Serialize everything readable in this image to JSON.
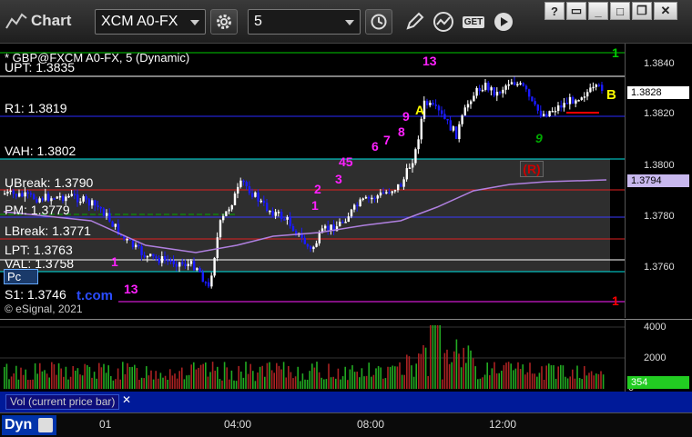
{
  "toolbar": {
    "title": "Chart",
    "symbol": "XCM A0-FX",
    "interval": "5",
    "get_label": "GET"
  },
  "window": {
    "minimize": "_",
    "restore": "❐",
    "close": "✕",
    "help": "?"
  },
  "chart": {
    "symbol_line": "* GBP@FXCM A0-FX, 5 (Dynamic)",
    "copyright": "© eSignal, 2021",
    "watermark": "t.com",
    "levels": [
      {
        "label": "UPT: 1.3835",
        "color": "#ffffff"
      },
      {
        "label": "R1: 1.3819",
        "color": "#2a2aff"
      },
      {
        "label": "VAH: 1.3802",
        "color": "#00e5e5"
      },
      {
        "label": "UBreak: 1.3790",
        "color": "#e02020"
      },
      {
        "label": "PM: 1.3779",
        "color": "#3a3aff"
      },
      {
        "label": "LBreak: 1.3771",
        "color": "#e02020"
      },
      {
        "label": "LPT: 1.3763",
        "color": "#ffffff"
      },
      {
        "label": "VAL: 1.3758",
        "color": "#00e5e5"
      },
      {
        "label": "S1: 1.3746",
        "color": "#ff20ff"
      }
    ],
    "pc_label": "Pc",
    "r_label": "(R)",
    "b_label": "B",
    "price_axis": {
      "ticks": [
        "1.3840",
        "1.3820",
        "1.3800",
        "1.3780",
        "1.3760"
      ],
      "last_price": "1.3828",
      "ma_value": "1.3794"
    },
    "markers": {
      "m1": "1",
      "m2": "2",
      "m3": "3",
      "m45": "45",
      "m6": "6",
      "m7": "7",
      "m8": "8",
      "m9": "9",
      "m13": "13",
      "m1b": "1",
      "m13b": "13",
      "mA": "A",
      "mRed1": "1",
      "mGreen1": "1",
      "mGreen9": "9"
    }
  },
  "volume": {
    "label": "Vol (current price bar)",
    "axis_ticks": [
      "4000",
      "2000",
      "0"
    ],
    "current": "354"
  },
  "time_axis": {
    "ticks": [
      "01",
      "04:00",
      "08:00",
      "12:00"
    ],
    "dyn": "Dyn"
  },
  "colors": {
    "up": "#ffffff",
    "down": "#1a1aff",
    "accent": "#ffff00",
    "vol_up": "#22aa22",
    "vol_down": "#aa2222"
  }
}
